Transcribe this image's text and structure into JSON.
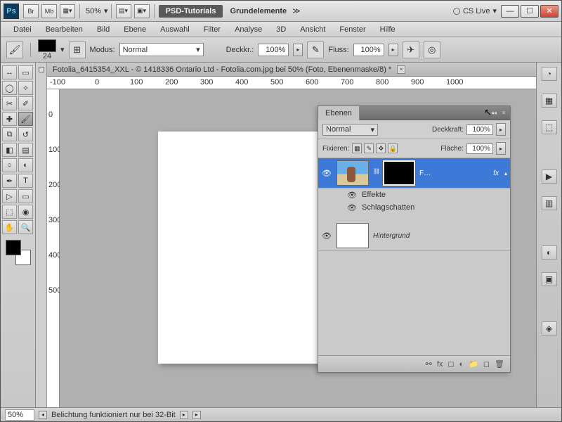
{
  "titlebar": {
    "logo": "Ps",
    "br": "Br",
    "mb": "Mb",
    "zoom": "50%",
    "tab_tutorials": "PSD-Tutorials",
    "tab_grund": "Grundelemente",
    "chev": "≫",
    "cs_live": "CS Live"
  },
  "menu": [
    "Datei",
    "Bearbeiten",
    "Bild",
    "Ebene",
    "Auswahl",
    "Filter",
    "Analyse",
    "3D",
    "Ansicht",
    "Fenster",
    "Hilfe"
  ],
  "opt": {
    "brush_size": "24",
    "modus_lbl": "Modus:",
    "modus_val": "Normal",
    "deck_lbl": "Deckkr.:",
    "deck_val": "100%",
    "fluss_lbl": "Fluss:",
    "fluss_val": "100%"
  },
  "doc": {
    "tab": "Fotolia_6415354_XXL - © 1418336 Ontario Ltd - Fotolia.com.jpg bei 50% (Foto, Ebenenmaske/8) *"
  },
  "ruler_h": [
    "-100",
    "0",
    "100",
    "200",
    "300",
    "400",
    "500",
    "600",
    "700",
    "800",
    "900",
    "1000"
  ],
  "ruler_v": [
    "0",
    "100",
    "200",
    "300",
    "400",
    "500"
  ],
  "layers": {
    "title": "Ebenen",
    "blend": "Normal",
    "deck_lbl": "Deckkraft:",
    "deck_val": "100%",
    "fix_lbl": "Fixieren:",
    "flach_lbl": "Fläche:",
    "flach_val": "100%",
    "layer1_name": "F…",
    "fx": "fx",
    "effekte": "Effekte",
    "schlag": "Schlagschatten",
    "bg": "Hintergrund"
  },
  "status": {
    "zoom": "50%",
    "msg": "Belichtung funktioniert nur bei 32-Bit"
  }
}
